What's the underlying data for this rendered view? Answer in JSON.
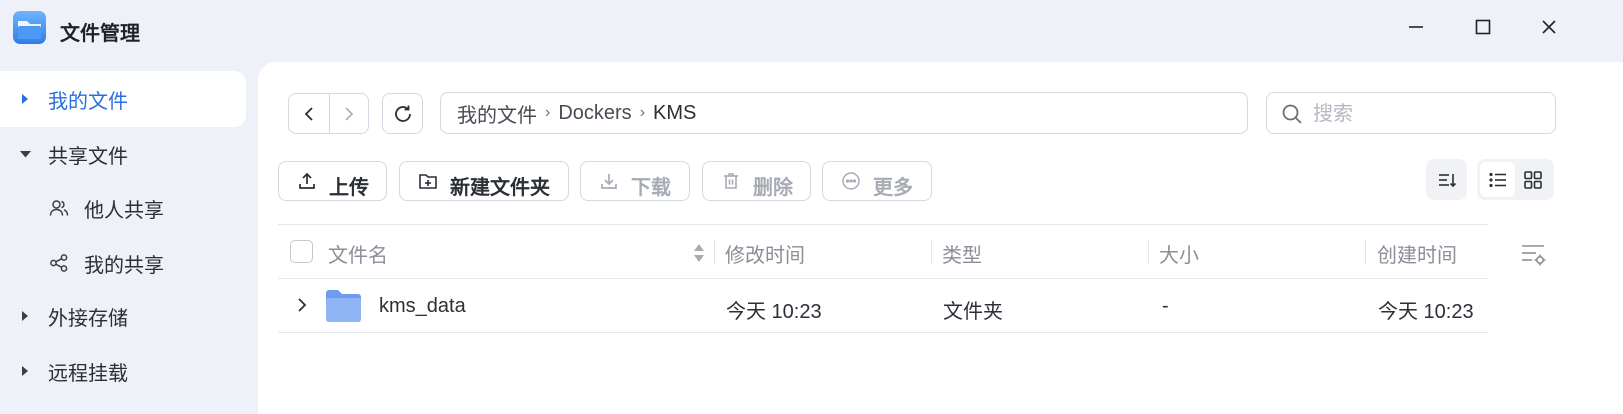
{
  "window": {
    "title": "文件管理",
    "controls": [
      "minimize-icon",
      "maximize-icon",
      "close-icon"
    ]
  },
  "sidebar": {
    "items": [
      {
        "label": "我的文件",
        "state": "collapsed",
        "active": true
      },
      {
        "label": "共享文件",
        "state": "expanded",
        "active": false
      },
      {
        "label": "他人共享",
        "icon": "users-icon",
        "active": false
      },
      {
        "label": "我的共享",
        "icon": "share-icon",
        "active": false
      },
      {
        "label": "外接存储",
        "state": "collapsed",
        "active": false
      },
      {
        "label": "远程挂载",
        "state": "collapsed",
        "active": false
      }
    ]
  },
  "breadcrumb": {
    "items": [
      "我的文件",
      "Dockers",
      "KMS"
    ]
  },
  "search": {
    "placeholder": "搜索",
    "value": ""
  },
  "toolbar": {
    "upload_label": "上传",
    "new_folder_label": "新建文件夹",
    "download_label": "下载",
    "delete_label": "删除",
    "more_label": "更多"
  },
  "table": {
    "columns": [
      "文件名",
      "修改时间",
      "类型",
      "大小",
      "创建时间"
    ],
    "rows": [
      {
        "name": "kms_data",
        "modified": "今天 10:23",
        "type": "文件夹",
        "size": "-",
        "created": "今天 10:23"
      }
    ]
  },
  "colors": {
    "accent": "#2a6fe0",
    "background": "#eef1f7",
    "panel": "#ffffff",
    "folder": "#8fb5f5"
  }
}
